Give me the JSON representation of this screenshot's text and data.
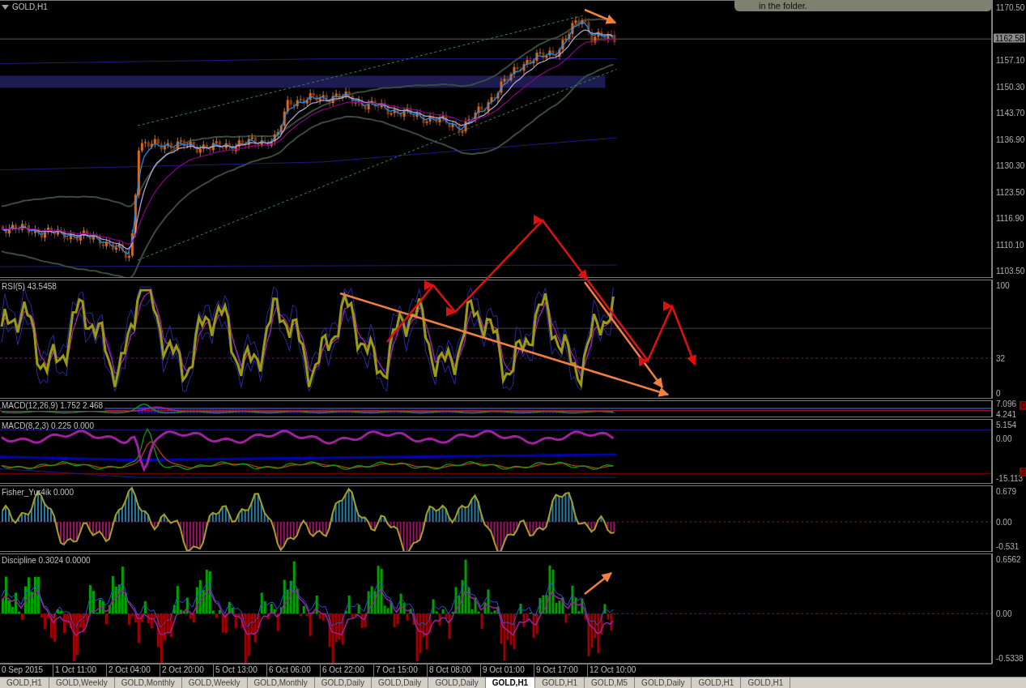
{
  "chart": {
    "symbol": "GOLD,H1",
    "notice": "in the folder.",
    "panes": [
      {
        "kind": "price",
        "ticks": [
          "1170.50",
          "1157.10",
          "1150.30",
          "1143.70",
          "1136.90",
          "1130.30",
          "1123.50",
          "1116.90",
          "1110.10",
          "1103.50"
        ],
        "current_price": "1162.58"
      },
      {
        "kind": "rsi",
        "title": "RSI(5) 43.5458",
        "ticks": [
          "100",
          "32",
          "0"
        ]
      },
      {
        "kind": "macd_hist",
        "title": "MACD(12,26,9) 1.752 2.468",
        "ticks": [
          "7.096",
          "4.241"
        ],
        "badge": "0"
      },
      {
        "kind": "macd_lines",
        "title": "MACD(8,2,3) 0.225 0.000",
        "ticks": [
          "5.154",
          "0.00",
          "-15.113"
        ],
        "badge": "2"
      },
      {
        "kind": "fisher",
        "title": "Fisher_Yur4ik 0.000",
        "ticks": [
          "0.679",
          "0.00",
          "-0.531"
        ]
      },
      {
        "kind": "discipline",
        "title": "Discipline 0.3024 0.0000",
        "ticks": [
          "0.6562",
          "0.00",
          "-0.5338"
        ]
      }
    ],
    "time_axis": [
      "0 Sep 2015",
      "1 Oct 11:00",
      "2 Oct 04:00",
      "2 Oct 20:00",
      "5 Oct 13:00",
      "6 Oct 06:00",
      "6 Oct 22:00",
      "7 Oct 15:00",
      "8 Oct 08:00",
      "9 Oct 01:00",
      "9 Oct 17:00",
      "12 Oct 10:00"
    ],
    "tabs": [
      {
        "label": "GOLD,H1",
        "selected": false
      },
      {
        "label": "GOLD,Weekly",
        "selected": false
      },
      {
        "label": "GOLD,Monthly",
        "selected": false
      },
      {
        "label": "GOLD,Weekly",
        "selected": false
      },
      {
        "label": "GOLD,Monthly",
        "selected": false
      },
      {
        "label": "GOLD,Daily",
        "selected": false
      },
      {
        "label": "GOLD,Daily",
        "selected": false
      },
      {
        "label": "GOLD,Daily",
        "selected": false
      },
      {
        "label": "GOLD,H1",
        "selected": true
      },
      {
        "label": "GOLD,H1",
        "selected": false
      },
      {
        "label": "GOLD,M5",
        "selected": false
      },
      {
        "label": "GOLD,Daily",
        "selected": false
      },
      {
        "label": "GOLD,H1",
        "selected": false
      },
      {
        "label": "GOLD,H1",
        "selected": false
      }
    ]
  }
}
